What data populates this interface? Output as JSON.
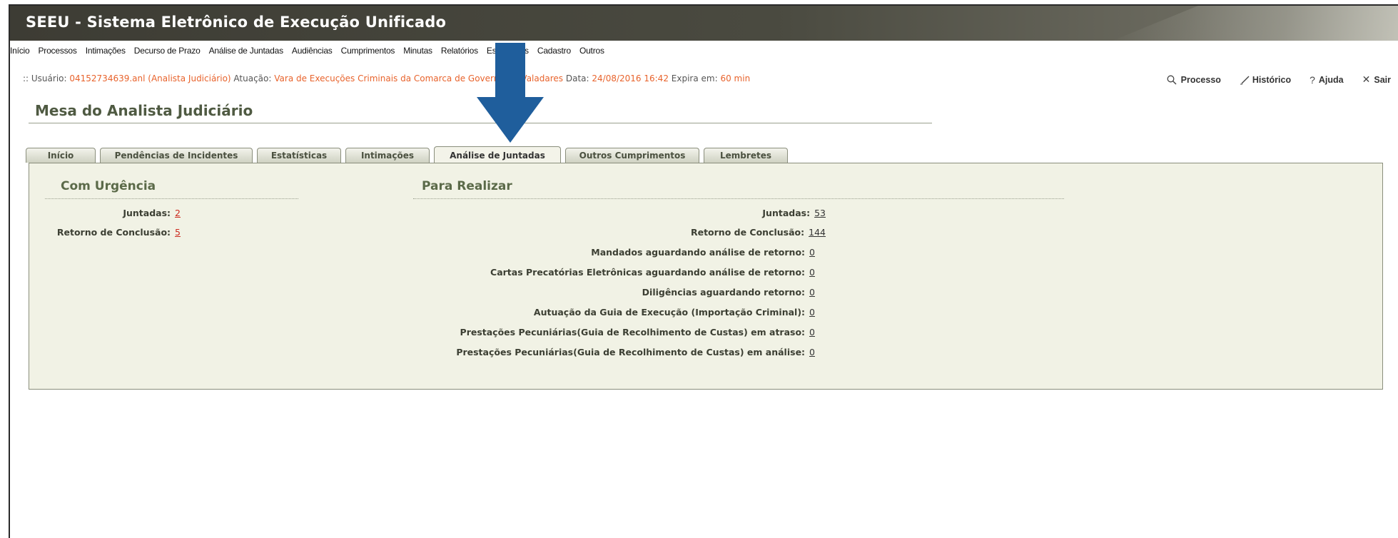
{
  "app": {
    "title": "SEEU - Sistema Eletrônico de Execução Unificado"
  },
  "menu": [
    "Início",
    "Processos",
    "Intimações",
    "Decurso de Prazo",
    "Análise de Juntadas",
    "Audiências",
    "Cumprimentos",
    "Minutas",
    "Relatórios",
    "Estatísticas",
    "Cadastro",
    "Outros"
  ],
  "userline": {
    "prefix": ":: Usuário:",
    "user": "04152734639.anl (Analista Judiciário)",
    "atuacao_label": "Atuação:",
    "atuacao": "Vara de Execuções Criminais da Comarca de Governador Valadares",
    "data_label": "Data:",
    "data": "24/08/2016 16:42",
    "expira_label": "Expira em:",
    "expira": "60 min"
  },
  "toolbar": {
    "processo": "Processo",
    "historico": "Histórico",
    "ajuda": "Ajuda",
    "sair": "Sair"
  },
  "page_title": "Mesa do Analista Judiciário",
  "tabs": [
    "Início",
    "Pendências de Incidentes",
    "Estatísticas",
    "Intimações",
    "Análise de Juntadas",
    "Outros Cumprimentos",
    "Lembretes"
  ],
  "active_tab": "Análise de Juntadas",
  "urgencia": {
    "title": "Com Urgência",
    "rows": [
      {
        "label": "Juntadas:",
        "value": "2"
      },
      {
        "label": "Retorno de Conclusão:",
        "value": "5"
      }
    ]
  },
  "realizar": {
    "title": "Para Realizar",
    "rows": [
      {
        "label": "Juntadas:",
        "value": "53"
      },
      {
        "label": "Retorno de Conclusão:",
        "value": "144"
      },
      {
        "label": "Mandados aguardando análise de retorno:",
        "value": "0"
      },
      {
        "label": "Cartas Precatórias Eletrônicas aguardando análise de retorno:",
        "value": "0"
      },
      {
        "label": "Diligências aguardando retorno:",
        "value": "0"
      },
      {
        "label": "Autuação da Guia de Execução (Importação Criminal):",
        "value": "0"
      },
      {
        "label": "Prestações Pecuniárias(Guia de Recolhimento de Custas) em atraso:",
        "value": "0"
      },
      {
        "label": "Prestações Pecuniárias(Guia de Recolhimento de Custas) em análise:",
        "value": "0"
      }
    ]
  },
  "colors": {
    "accent": "#e8632c",
    "header_dark": "#3d3c34",
    "panel_bg": "#f1f2e5",
    "arrow": "#1f5e9c",
    "link_red": "#cc2b1f"
  }
}
